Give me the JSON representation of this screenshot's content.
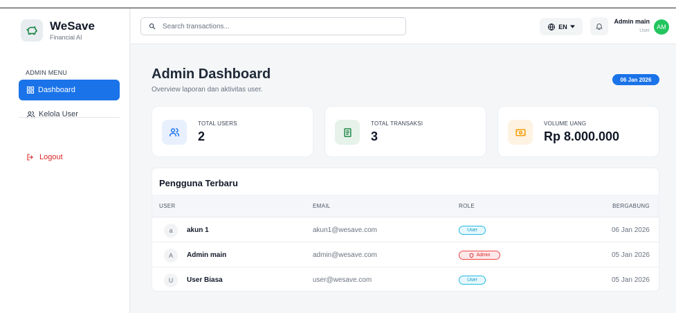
{
  "brand": {
    "name": "WeSave",
    "subtitle": "Financial AI"
  },
  "sidebar": {
    "menu_title": "ADMIN MENU",
    "items": [
      {
        "label": "Dashboard",
        "icon": "dashboard-grid-icon",
        "active": true
      },
      {
        "label": "Kelola User",
        "icon": "users-icon",
        "active": false
      }
    ],
    "logout_label": "Logout"
  },
  "header": {
    "search_placeholder": "Search transactions...",
    "language": "EN",
    "user_name": "Admin main",
    "user_role": "User",
    "avatar_initials": "AM"
  },
  "page": {
    "title": "Admin Dashboard",
    "subtitle": "Overview laporan dan aktivitas user.",
    "date_badge": "06 Jan 2026"
  },
  "stats": [
    {
      "label": "TOTAL USERS",
      "value": "2",
      "icon": "users-icon",
      "icon_color": "#1a73e8",
      "bg": "#e8f0fe"
    },
    {
      "label": "TOTAL TRANSAKSI",
      "value": "3",
      "icon": "receipt-icon",
      "icon_color": "#15803d",
      "bg": "#e6f2ea"
    },
    {
      "label": "VOLUME UANG",
      "value": "Rp 8.000.000",
      "icon": "money-icon",
      "icon_color": "#f59e0b",
      "bg": "#fef3e2"
    }
  ],
  "table": {
    "title": "Pengguna Terbaru",
    "columns": [
      "USER",
      "EMAIL",
      "ROLE",
      "BERGABUNG"
    ],
    "rows": [
      {
        "initial": "a",
        "name": "akun 1",
        "email": "akun1@wesave.com",
        "role": "User",
        "joined": "06 Jan 2026"
      },
      {
        "initial": "A",
        "name": "Admin main",
        "email": "admin@wesave.com",
        "role": "Admin",
        "joined": "05 Jan 2026"
      },
      {
        "initial": "U",
        "name": "User Biasa",
        "email": "user@wesave.com",
        "role": "User",
        "joined": "05 Jan 2026"
      }
    ]
  }
}
